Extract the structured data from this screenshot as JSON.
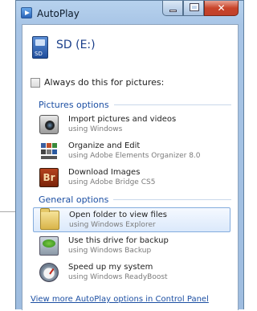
{
  "window": {
    "title": "AutoPlay"
  },
  "device": {
    "name": "SD (E:)"
  },
  "always_checkbox": {
    "label": "Always do this for pictures:",
    "checked": false
  },
  "sections": {
    "pictures": {
      "header": "Pictures options"
    },
    "general": {
      "header": "General options"
    }
  },
  "options": [
    {
      "title": "Import pictures and videos",
      "sub": "using Windows",
      "icon": "camera-icon"
    },
    {
      "title": "Organize and Edit",
      "sub": "using Adobe Elements Organizer 8.0",
      "icon": "organizer-icon"
    },
    {
      "title": "Download Images",
      "sub": "using Adobe Bridge CS5",
      "icon": "bridge-icon",
      "icon_text": "Br"
    },
    {
      "title": "Open folder to view files",
      "sub": "using Windows Explorer",
      "icon": "folder-icon",
      "selected": true
    },
    {
      "title": "Use this drive for backup",
      "sub": "using Windows Backup",
      "icon": "backup-icon"
    },
    {
      "title": "Speed up my system",
      "sub": "using Windows ReadyBoost",
      "icon": "speedometer-icon"
    }
  ],
  "footer": {
    "link": "View more AutoPlay options in Control Panel"
  },
  "colors": {
    "section_header": "#1c4fa3",
    "selection_border": "#84acdd",
    "link": "#1c4fa3"
  }
}
